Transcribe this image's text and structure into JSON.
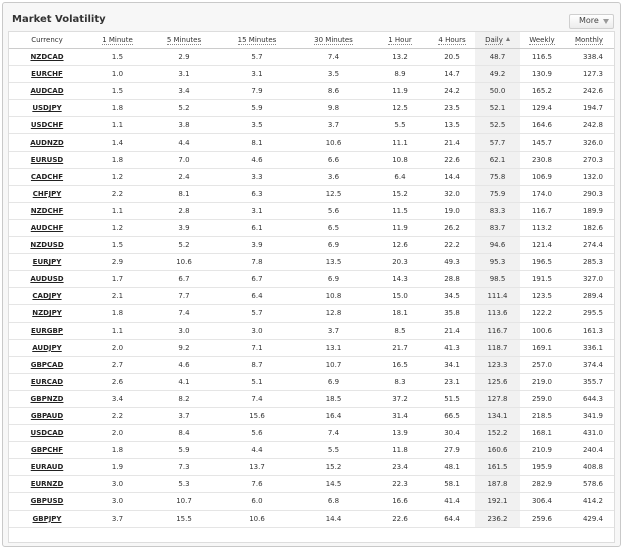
{
  "widget": {
    "title": "Market Volatility",
    "more_label": "More"
  },
  "columns": [
    "Currency",
    "1 Minute",
    "5 Minutes",
    "15 Minutes",
    "30 Minutes",
    "1 Hour",
    "4 Hours",
    "Daily",
    "Weekly",
    "Monthly"
  ],
  "sorted_column": "Daily",
  "rows": [
    [
      "NZDCAD",
      "1.5",
      "2.9",
      "5.7",
      "7.4",
      "13.2",
      "20.5",
      "48.7",
      "116.5",
      "338.4"
    ],
    [
      "EURCHF",
      "1.0",
      "3.1",
      "3.1",
      "3.5",
      "8.9",
      "14.7",
      "49.2",
      "130.9",
      "127.3"
    ],
    [
      "AUDCAD",
      "1.5",
      "3.4",
      "7.9",
      "8.6",
      "11.9",
      "24.2",
      "50.0",
      "165.2",
      "242.6"
    ],
    [
      "USDJPY",
      "1.8",
      "5.2",
      "5.9",
      "9.8",
      "12.5",
      "23.5",
      "52.1",
      "129.4",
      "194.7"
    ],
    [
      "USDCHF",
      "1.1",
      "3.8",
      "3.5",
      "3.7",
      "5.5",
      "13.5",
      "52.5",
      "164.6",
      "242.8"
    ],
    [
      "AUDNZD",
      "1.4",
      "4.4",
      "8.1",
      "10.6",
      "11.1",
      "21.4",
      "57.7",
      "145.7",
      "326.0"
    ],
    [
      "EURUSD",
      "1.8",
      "7.0",
      "4.6",
      "6.6",
      "10.8",
      "22.6",
      "62.1",
      "230.8",
      "270.3"
    ],
    [
      "CADCHF",
      "1.2",
      "2.4",
      "3.3",
      "3.6",
      "6.4",
      "14.4",
      "75.8",
      "106.9",
      "132.0"
    ],
    [
      "CHFJPY",
      "2.2",
      "8.1",
      "6.3",
      "12.5",
      "15.2",
      "32.0",
      "75.9",
      "174.0",
      "290.3"
    ],
    [
      "NZDCHF",
      "1.1",
      "2.8",
      "3.1",
      "5.6",
      "11.5",
      "19.0",
      "83.3",
      "116.7",
      "189.9"
    ],
    [
      "AUDCHF",
      "1.2",
      "3.9",
      "6.1",
      "6.5",
      "11.9",
      "26.2",
      "83.7",
      "113.2",
      "182.6"
    ],
    [
      "NZDUSD",
      "1.5",
      "5.2",
      "3.9",
      "6.9",
      "12.6",
      "22.2",
      "94.6",
      "121.4",
      "274.4"
    ],
    [
      "EURJPY",
      "2.9",
      "10.6",
      "7.8",
      "13.5",
      "20.3",
      "49.3",
      "95.3",
      "196.5",
      "285.3"
    ],
    [
      "AUDUSD",
      "1.7",
      "6.7",
      "6.7",
      "6.9",
      "14.3",
      "28.8",
      "98.5",
      "191.5",
      "327.0"
    ],
    [
      "CADJPY",
      "2.1",
      "7.7",
      "6.4",
      "10.8",
      "15.0",
      "34.5",
      "111.4",
      "123.5",
      "289.4"
    ],
    [
      "NZDJPY",
      "1.8",
      "7.4",
      "5.7",
      "12.8",
      "18.1",
      "35.8",
      "113.6",
      "122.2",
      "295.5"
    ],
    [
      "EURGBP",
      "1.1",
      "3.0",
      "3.0",
      "3.7",
      "8.5",
      "21.4",
      "116.7",
      "100.6",
      "161.3"
    ],
    [
      "AUDJPY",
      "2.0",
      "9.2",
      "7.1",
      "13.1",
      "21.7",
      "41.3",
      "118.7",
      "169.1",
      "336.1"
    ],
    [
      "GBPCAD",
      "2.7",
      "4.6",
      "8.7",
      "10.7",
      "16.5",
      "34.1",
      "123.3",
      "257.0",
      "374.4"
    ],
    [
      "EURCAD",
      "2.6",
      "4.1",
      "5.1",
      "6.9",
      "8.3",
      "23.1",
      "125.6",
      "219.0",
      "355.7"
    ],
    [
      "GBPNZD",
      "3.4",
      "8.2",
      "7.4",
      "18.5",
      "37.2",
      "51.5",
      "127.8",
      "259.0",
      "644.3"
    ],
    [
      "GBPAUD",
      "2.2",
      "3.7",
      "15.6",
      "16.4",
      "31.4",
      "66.5",
      "134.1",
      "218.5",
      "341.9"
    ],
    [
      "USDCAD",
      "2.0",
      "8.4",
      "5.6",
      "7.4",
      "13.9",
      "30.4",
      "152.2",
      "168.1",
      "431.0"
    ],
    [
      "GBPCHF",
      "1.8",
      "5.9",
      "4.4",
      "5.5",
      "11.8",
      "27.9",
      "160.6",
      "210.9",
      "240.4"
    ],
    [
      "EURAUD",
      "1.9",
      "7.3",
      "13.7",
      "15.2",
      "23.4",
      "48.1",
      "161.5",
      "195.9",
      "408.8"
    ],
    [
      "EURNZD",
      "3.0",
      "5.3",
      "7.6",
      "14.5",
      "22.3",
      "58.1",
      "187.8",
      "282.9",
      "578.6"
    ],
    [
      "GBPUSD",
      "3.0",
      "10.7",
      "6.0",
      "6.8",
      "16.6",
      "41.4",
      "192.1",
      "306.4",
      "414.2"
    ],
    [
      "GBPJPY",
      "3.7",
      "15.5",
      "10.6",
      "14.4",
      "22.6",
      "64.4",
      "236.2",
      "259.6",
      "429.4"
    ]
  ]
}
